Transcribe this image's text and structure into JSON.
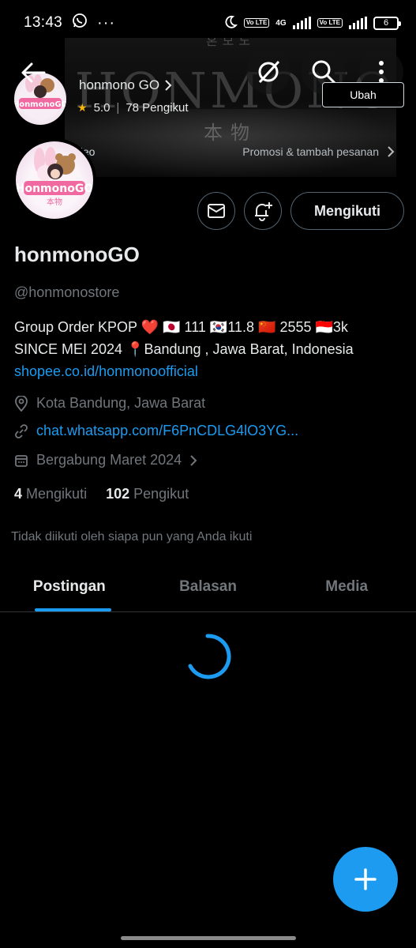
{
  "status_bar": {
    "time": "13:43",
    "net_4g": "4G",
    "volte": "Vo LTE",
    "battery": "6"
  },
  "banner": {
    "brand": "HONMONO",
    "kanji": "本物",
    "korean": "혼모노"
  },
  "shop": {
    "name": "honmono GO",
    "rating": "5.0",
    "followers": "78 Pengikut",
    "edit_label": "Ubah",
    "video_label": "ideo",
    "promo_label": "Promosi & tambah pesanan"
  },
  "profile": {
    "display_name": "honmonoGO",
    "handle": "@honmonostore",
    "bio_line1": "Group Order KPOP ❤️ 🇯🇵 111 🇰🇷11.8 🇨🇳 2555 🇮🇩3k",
    "bio_line2": "SINCE MEI 2024 📍Bandung , Jawa Barat, Indonesia",
    "bio_link": "shopee.co.id/honmonoofficial",
    "location": "Kota Bandung, Jawa Barat",
    "website": "chat.whatsapp.com/F6PnCDLG4lO3YG...",
    "joined": "Bergabung Maret 2024",
    "following_count": "4",
    "following_label": "Mengikuti",
    "followers_count": "102",
    "followers_label": "Pengikut",
    "not_followed": "Tidak diikuti oleh siapa pun yang Anda ikuti",
    "follow_button": "Mengikuti"
  },
  "avatar_logo": {
    "text": "HonmonoGO"
  },
  "tabs": [
    {
      "label": "Postingan",
      "active": true
    },
    {
      "label": "Balasan",
      "active": false
    },
    {
      "label": "Media",
      "active": false
    }
  ],
  "colors": {
    "accent": "#1d9bf0",
    "text_primary": "#e7e9ea",
    "text_secondary": "#71767b",
    "star": "#f5b50a"
  }
}
